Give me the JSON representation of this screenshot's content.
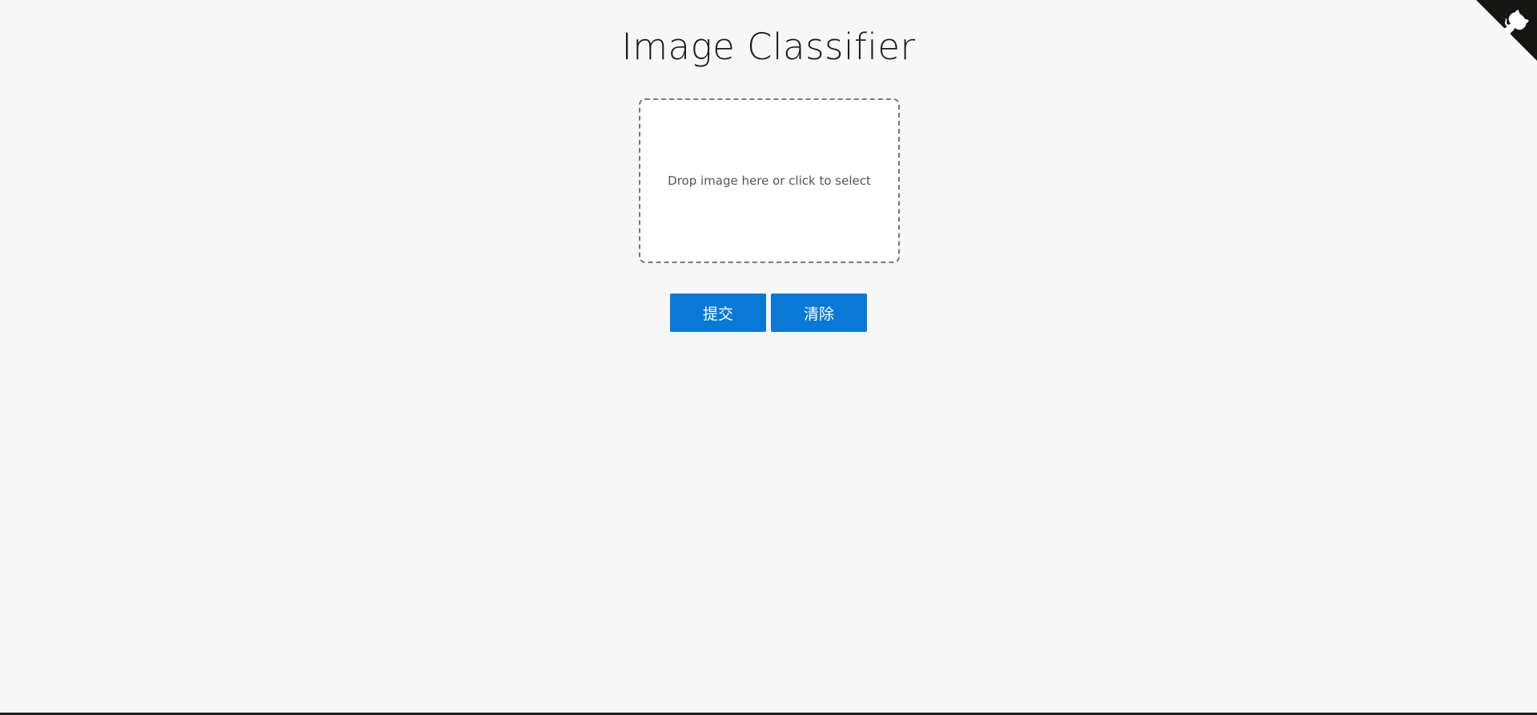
{
  "page": {
    "title": "Image Classifier"
  },
  "dropzone": {
    "text": "Drop image here or click to select"
  },
  "actions": {
    "submit_label": "提交",
    "clear_label": "清除"
  },
  "corner": {
    "icon": "github-octocat-icon",
    "background": "#151513",
    "foreground": "#ffffff"
  },
  "colors": {
    "page_background": "#f7f7f7",
    "button": "#0a78d7",
    "button_text": "#ffffff",
    "dropzone_border": "#777777"
  }
}
